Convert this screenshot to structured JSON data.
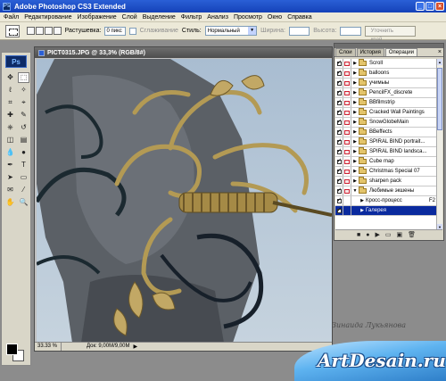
{
  "app": {
    "title": "Adobe Photoshop CS3 Extended",
    "icon_label": "Ps"
  },
  "menu": [
    "Файл",
    "Редактирование",
    "Изображение",
    "Слой",
    "Выделение",
    "Фильтр",
    "Анализ",
    "Просмотр",
    "Окно",
    "Справка"
  ],
  "options": {
    "feather_label": "Растушевка:",
    "feather_value": "0 пикс",
    "antialias_label": "Сглаживание",
    "style_label": "Стиль:",
    "style_value": "Нормальный",
    "width_label": "Ширина:",
    "height_label": "Высота:",
    "refine_label": "Уточнить край..."
  },
  "toolbox": {
    "logo": "Ps",
    "tools": [
      "move-tool-icon",
      "marquee-tool-icon",
      "lasso-tool-icon",
      "magic-wand-icon",
      "crop-tool-icon",
      "slice-tool-icon",
      "healing-brush-icon",
      "brush-tool-icon",
      "clone-stamp-icon",
      "history-brush-icon",
      "eraser-tool-icon",
      "gradient-tool-icon",
      "blur-tool-icon",
      "dodge-tool-icon",
      "pen-tool-icon",
      "type-tool-icon",
      "path-select-icon",
      "shape-tool-icon",
      "notes-tool-icon",
      "eyedropper-icon",
      "hand-tool-icon",
      "zoom-tool-icon"
    ],
    "glyphs": [
      "✥",
      "⬚",
      "ℓ",
      "✧",
      "⌗",
      "⌖",
      "✚",
      "✎",
      "⎈",
      "↺",
      "◫",
      "▤",
      "💧",
      "●",
      "✒",
      "T",
      "➤",
      "▭",
      "✉",
      "⁄",
      "✋",
      "🔍"
    ]
  },
  "document": {
    "title": "PICT0315.JPG @ 33,3% (RGB/8#)",
    "zoom": "33.33 %",
    "info": "Док: 9,00M/9,00M"
  },
  "actions_panel": {
    "tabs": [
      "Слои",
      "История",
      "Операции"
    ],
    "active_tab": "Операции",
    "items": [
      {
        "label": "Scroll",
        "type": "folder"
      },
      {
        "label": "balloons",
        "type": "folder"
      },
      {
        "label": "учимыы",
        "type": "folder"
      },
      {
        "label": "PencilFX_discrete",
        "type": "folder"
      },
      {
        "label": "BBfilmstrip",
        "type": "folder"
      },
      {
        "label": "Cracked Wall Paintings",
        "type": "folder"
      },
      {
        "label": "SnowGlobeMain",
        "type": "folder"
      },
      {
        "label": "BBeffects",
        "type": "folder"
      },
      {
        "label": "SPIRAL BIND portrait...",
        "type": "folder"
      },
      {
        "label": "SPIRAL BIND landsca...",
        "type": "folder"
      },
      {
        "label": "Cube map",
        "type": "folder"
      },
      {
        "label": "Christmas Special 07",
        "type": "folder"
      },
      {
        "label": "sharpen pack",
        "type": "folder"
      },
      {
        "label": "Любимые экшены",
        "type": "folder-open"
      },
      {
        "label": "Кросс-процесс",
        "type": "action",
        "key": "F2"
      },
      {
        "label": "Галерея",
        "type": "action",
        "selected": true
      }
    ]
  },
  "watermark": {
    "signature": "Зинаида Лукьянова",
    "brand": "ArtDesain.ru"
  }
}
